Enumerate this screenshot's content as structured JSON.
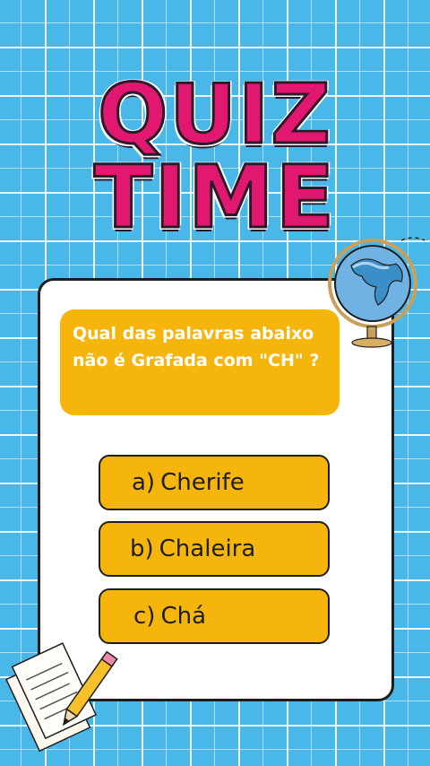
{
  "title": {
    "line1": "QUIZ",
    "line2": "TIME"
  },
  "question": "Qual das palavras abaixo não é Grafada com \"CH\" ?",
  "options": [
    {
      "letter": "a)",
      "text": "Cherife"
    },
    {
      "letter": "b)",
      "text": "Chaleira"
    },
    {
      "letter": "c)",
      "text": "Chá"
    }
  ],
  "icons": {
    "globe": "globe-icon",
    "notes": "notepad-pencil-icon"
  },
  "colors": {
    "background": "#49b8e8",
    "title": "#e2176f",
    "accent": "#f6b50a",
    "card": "#ffffff",
    "outline": "#1e1e1e"
  }
}
